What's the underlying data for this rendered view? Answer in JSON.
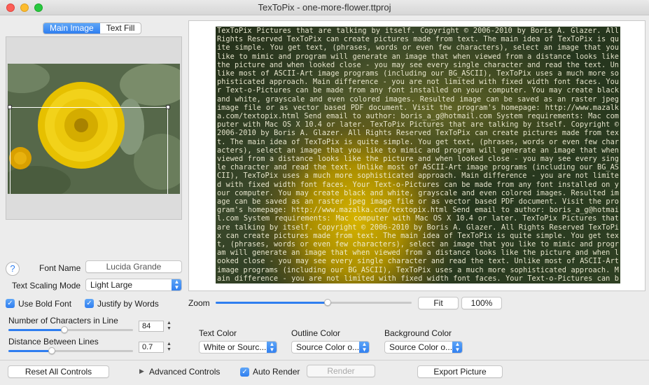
{
  "window": {
    "title": "TexToPix - one-more-flower.ttproj"
  },
  "tabs": [
    {
      "label": "Main Image",
      "active": true
    },
    {
      "label": "Text Fill",
      "active": false
    }
  ],
  "controls": {
    "help": "?",
    "font_name_label": "Font Name",
    "font_name_value": "Lucida Grande",
    "text_scaling_label": "Text Scaling Mode",
    "text_scaling_value": "Light Large",
    "use_bold_label": "Use Bold Font",
    "use_bold_checked": true,
    "justify_label": "Justify by Words",
    "justify_checked": true,
    "chars_label": "Number of Characters in Line",
    "chars_value": "84",
    "chars_level": 0.45,
    "distance_label": "Distance Between Lines",
    "distance_value": "0.7",
    "distance_level": 0.35,
    "zoom_label": "Zoom",
    "zoom_level": 0.57,
    "fit_label": "Fit",
    "zoom_100_label": "100%",
    "text_color_label": "Text Color",
    "text_color_value": "White or Sourc...",
    "outline_color_label": "Outline Color",
    "outline_color_value": "Source Color o...",
    "background_color_label": "Background Color",
    "background_color_value": "Source Color o...",
    "reset_label": "Reset All Controls",
    "advanced_label": "Advanced Controls",
    "auto_render_label": "Auto Render",
    "auto_render_checked": true,
    "render_label": "Render",
    "export_label": "Export Picture"
  },
  "preview_text": "TexToPix Pictures that are talking by itself. Copyright © 2006-2010 by Boris A. Glazer. All Rights Reserved TexToPix can create pictures made from text. The main idea of TexToPix is quite simple. You get text, (phrases, words or even few characters), select an image that you like to mimic and program will generate an image that when viewed from a distance looks like the picture and when looked close - you may see every single character and read the text. Unlike most of ASCII-Art image programs (including our BG_ASCII), TexToPix uses a much more sophisticated approach. Main difference - you are not limited with fixed width font faces. Your Text-o-Pictures can be made from any font installed on your computer. You may create black and white, grayscale and even colored images. Resulted image can be saved as an raster jpeg image file or as vector based PDF document. Visit the program's homepage: http://www.mazalka.com/textopix.html Send email to author: boris_a_g@hotmail.com System requirements: Mac computer with Mac OS X 10.4 or later. TexToPix Pictures that are talking by itself. Copyright © 2006-2010 by Boris A. Glazer. All Rights Reserved TexToPix can create pictures made from text. The main idea of TexToPix is quite simple. You get text, (phrases, words or even few characters), select an image that you like to mimic and program will generate an image that when viewed from a distance looks like the picture and when looked close - you may see every single character and read the text. Unlike most of ASCII-Art image programs (including our BG_ASCII), TexToPix uses a much more sophisticated approach. Main difference - you are not limited with fixed width font faces. Your Text-o-Pictures can be made from any font installed on your computer. You may create black and white, grayscale and even colored images. Resulted image can be saved as an raster jpeg image file or as vector based PDF document. Visit the program's homepage: http://www.mazalka.com/textopix.html Send email to author: boris_a_g@hotmail.com System requirements: Mac computer with Mac OS X 10.4 or later. TexToPix Pictures that are talking by itself. Copyright © 2006-2010 by Boris A. Glazer. All Rights Reserved TexToPix can create pictures made from text. The main idea of TexToPix is quite simple. You get text, (phrases, words or even few characters), select an image that you like to mimic and program will generate an image that when viewed from a distance looks like the picture and when looked close - you may see every single character and read the text. Unlike most of ASCII-Art image programs (including our BG_ASCII), TexToPix uses a much more sophisticated approach. Main difference - you are not limited with fixed width font faces. Your Text-o-Pictures can be made from any font installed on your computer. You may create black and white, grayscale and even colored",
  "colors": {
    "accent": "#2f7ef0",
    "flower": "#f2d21a"
  }
}
